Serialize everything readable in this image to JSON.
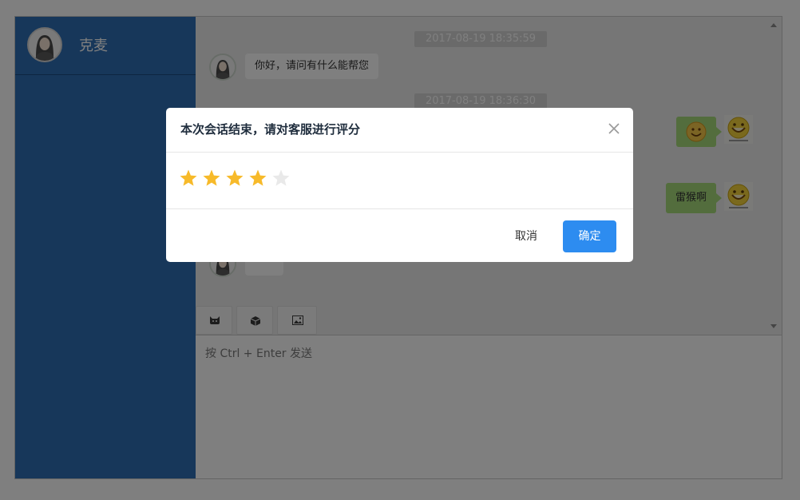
{
  "sidebar": {
    "user_name": "克麦"
  },
  "chat": {
    "messages": [
      {
        "timestamp": "2017-08-19 18:35:59",
        "text": "你好，请问有什么能帮您"
      },
      {
        "timestamp": "2017-08-19 18:36:30"
      },
      {
        "text": "雷猴啊"
      }
    ]
  },
  "composer": {
    "placeholder": "按 Ctrl + Enter 发送"
  },
  "dialog": {
    "title": "本次会话结束，请对客服进行评分",
    "rating": 4,
    "rating_max": 5,
    "cancel_label": "取消",
    "ok_label": "确定",
    "colors": {
      "star_active": "#f7ba2a",
      "star_inactive": "#e9e9e9",
      "primary": "#2d8cf0",
      "sidebar": "#2e6eb4"
    }
  }
}
